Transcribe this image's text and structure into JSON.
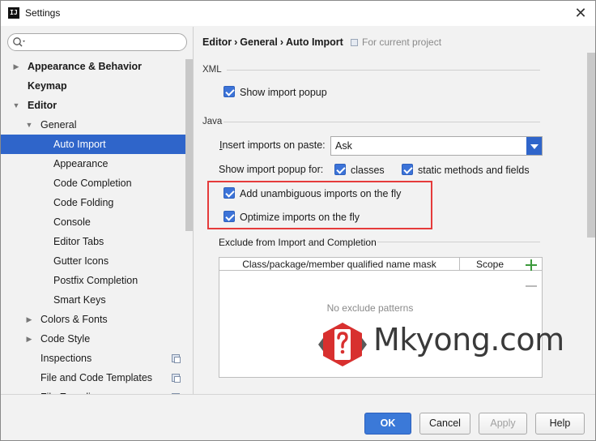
{
  "window": {
    "title": "Settings",
    "app_icon": "IJ"
  },
  "sidebar": {
    "search_placeholder": "",
    "items": [
      {
        "label": "Appearance & Behavior",
        "level": 0,
        "arrow": "right",
        "bold": true
      },
      {
        "label": "Keymap",
        "level": 0,
        "arrow": "",
        "bold": true
      },
      {
        "label": "Editor",
        "level": 0,
        "arrow": "down",
        "bold": true
      },
      {
        "label": "General",
        "level": 1,
        "arrow": "down"
      },
      {
        "label": "Auto Import",
        "level": 2,
        "arrow": "",
        "selected": true
      },
      {
        "label": "Appearance",
        "level": 2,
        "arrow": ""
      },
      {
        "label": "Code Completion",
        "level": 2,
        "arrow": ""
      },
      {
        "label": "Code Folding",
        "level": 2,
        "arrow": ""
      },
      {
        "label": "Console",
        "level": 2,
        "arrow": ""
      },
      {
        "label": "Editor Tabs",
        "level": 2,
        "arrow": ""
      },
      {
        "label": "Gutter Icons",
        "level": 2,
        "arrow": ""
      },
      {
        "label": "Postfix Completion",
        "level": 2,
        "arrow": ""
      },
      {
        "label": "Smart Keys",
        "level": 2,
        "arrow": ""
      },
      {
        "label": "Colors & Fonts",
        "level": 1,
        "arrow": "right"
      },
      {
        "label": "Code Style",
        "level": 1,
        "arrow": "right"
      },
      {
        "label": "Inspections",
        "level": 1,
        "arrow": "",
        "project_icon": true
      },
      {
        "label": "File and Code Templates",
        "level": 1,
        "arrow": "",
        "project_icon": true
      },
      {
        "label": "File Encodings",
        "level": 1,
        "arrow": "",
        "project_icon": true
      }
    ]
  },
  "main": {
    "breadcrumb": [
      "Editor",
      "General",
      "Auto Import"
    ],
    "breadcrumb_sep": "›",
    "scope_note": "For current project",
    "xml_section": "XML",
    "xml_show_popup": "Show import popup",
    "java_section": "Java",
    "insert_label_u": "I",
    "insert_label_rest": "nsert imports on paste:",
    "insert_value": "Ask",
    "popup_for_label": "Show import popup for:",
    "popup_classes": "classes",
    "popup_static": "static methods and fields",
    "add_unambiguous": "Add unambiguous imports on the fly",
    "optimize": "Optimize imports on the fly",
    "exclude_section": "Exclude from Import and Completion",
    "table_col_mask": "Class/package/member qualified name mask",
    "table_col_scope": "Scope",
    "table_empty": "No exclude patterns"
  },
  "watermark": {
    "text": "Mkyong.com"
  },
  "footer": {
    "ok": "OK",
    "cancel": "Cancel",
    "apply": "Apply",
    "help": "Help"
  },
  "colors": {
    "accent": "#2f65ca",
    "highlight": "#e53b3b",
    "watermark_logo": "#d8302f"
  }
}
